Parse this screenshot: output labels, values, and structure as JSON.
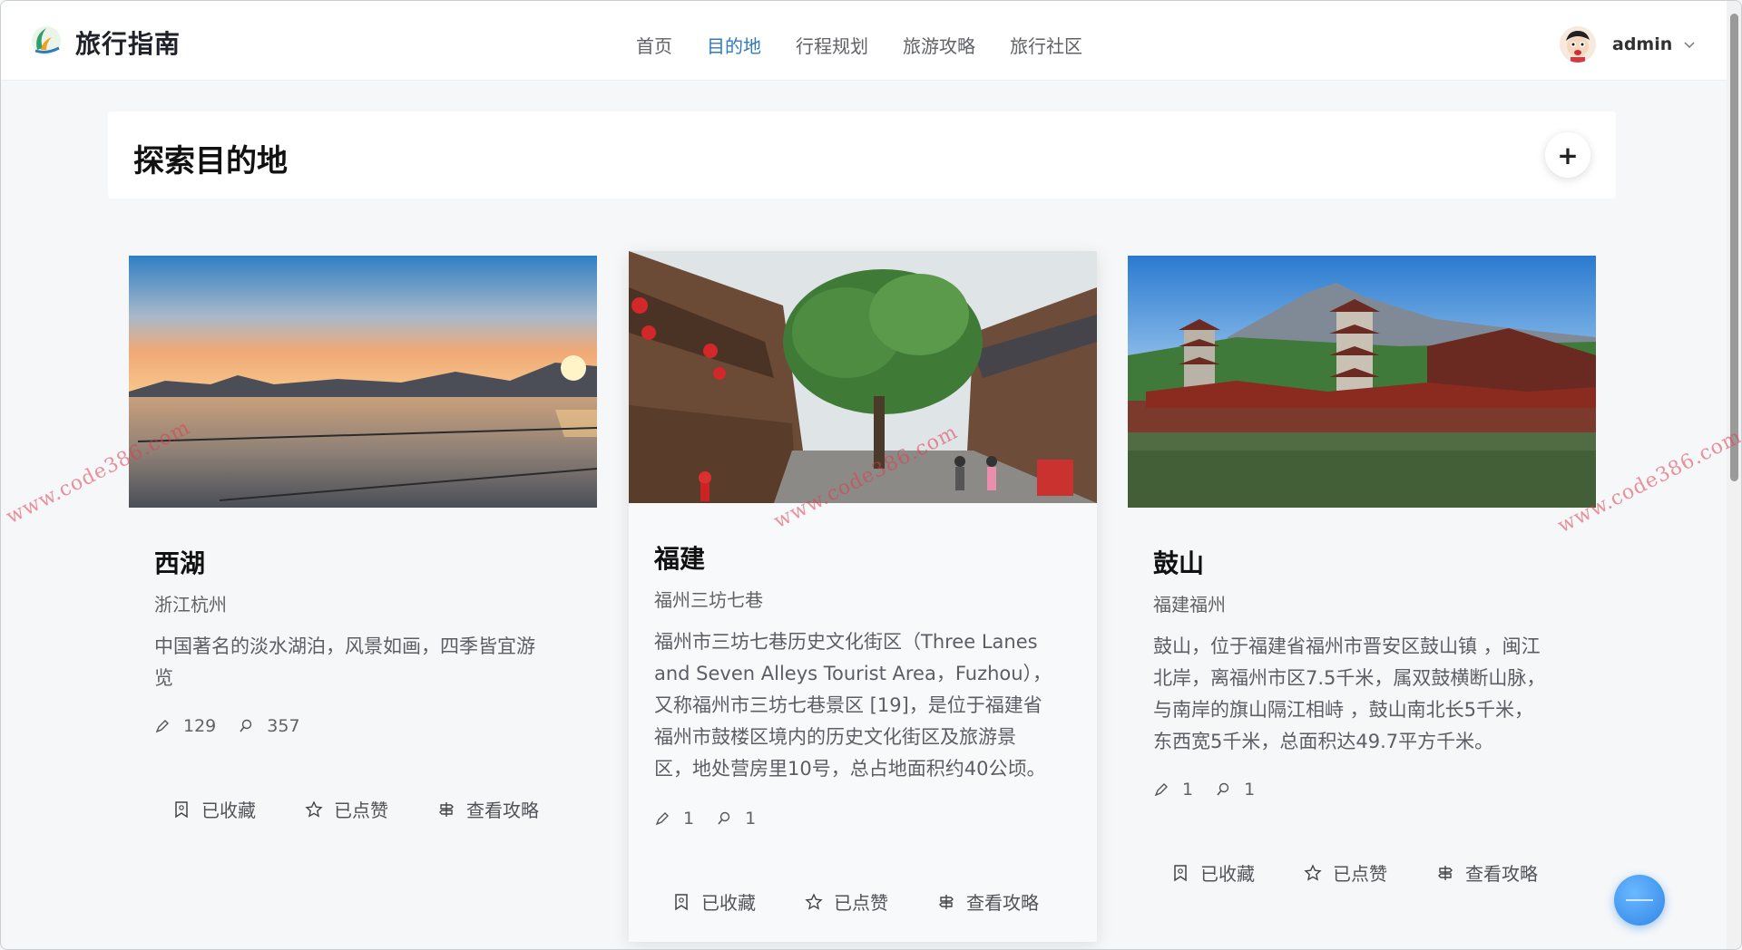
{
  "header": {
    "brand": "旅行指南",
    "nav": [
      "首页",
      "目的地",
      "行程规划",
      "旅游攻略",
      "旅行社区"
    ],
    "active_nav": "目的地",
    "username": "admin"
  },
  "page": {
    "title": "探索目的地",
    "add_label": "+"
  },
  "cards": [
    {
      "name": "西湖",
      "location": "浙江杭州",
      "description": "中国著名的淡水湖泊，风景如画，四季皆宜游览",
      "stat1": "129",
      "stat2": "357",
      "actions": [
        "已收藏",
        "已点赞",
        "查看攻略"
      ]
    },
    {
      "name": "福建",
      "location": "福州三坊七巷",
      "description": "福州市三坊七巷历史文化街区（Three Lanes and Seven Alleys Tourist Area，Fuzhou），又称福州市三坊七巷景区 [19]，是位于福建省福州市鼓楼区境内的历史文化街区及旅游景区，地处营房里10号，总占地面积约40公顷。",
      "stat1": "1",
      "stat2": "1",
      "actions": [
        "已收藏",
        "已点赞",
        "查看攻略"
      ]
    },
    {
      "name": "鼓山",
      "location": "福建福州",
      "description": "鼓山，位于福建省福州市晋安区鼓山镇 ，闽江北岸，离福州市区7.5千米，属双鼓横断山脉，与南岸的旗山隔江相峙 ，鼓山南北长5千米，东西宽5千米，总面积达49.7平方千米。",
      "stat1": "1",
      "stat2": "1",
      "actions": [
        "已收藏",
        "已点赞",
        "查看攻略"
      ]
    }
  ],
  "watermark": "www.code386.com",
  "colors": {
    "accent": "#2f7ab8",
    "fab": "#3a8ee8",
    "watermark": "#dc3c50"
  }
}
